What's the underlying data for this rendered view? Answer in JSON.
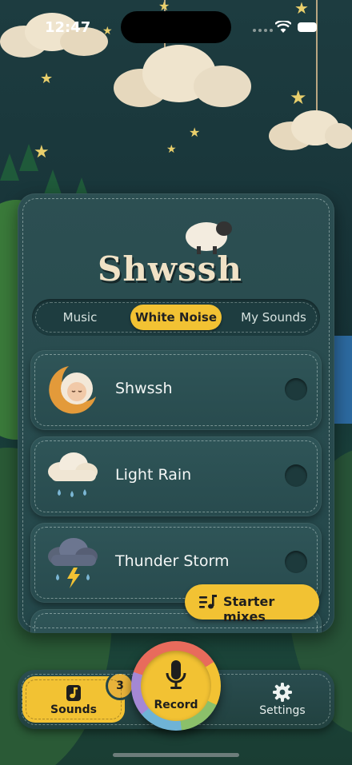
{
  "status_bar": {
    "time": "12:47"
  },
  "app": {
    "logo_text": "Shwssh"
  },
  "tabs": {
    "items": [
      {
        "label": "Music",
        "active": false
      },
      {
        "label": "White Noise",
        "active": true
      },
      {
        "label": "My Sounds",
        "active": false
      }
    ]
  },
  "sounds": [
    {
      "title": "Shwssh",
      "icon": "sleeping-sheep-moon-icon",
      "enabled": false
    },
    {
      "title": "Light Rain",
      "icon": "rain-cloud-icon",
      "enabled": false
    },
    {
      "title": "Thunder Storm",
      "icon": "thunder-cloud-icon",
      "enabled": false
    }
  ],
  "starter_mixes": {
    "label": "Starter mixes",
    "icon": "music-list-icon"
  },
  "tab_bar": {
    "sounds": {
      "label": "Sounds",
      "badge": "3",
      "icon": "music-note-icon"
    },
    "record": {
      "label": "Record",
      "icon": "microphone-icon"
    },
    "settings": {
      "label": "Settings",
      "icon": "gear-icon"
    }
  },
  "colors": {
    "accent": "#f2c233",
    "panel": "#2a4d50",
    "background": "#1a3a3e"
  }
}
